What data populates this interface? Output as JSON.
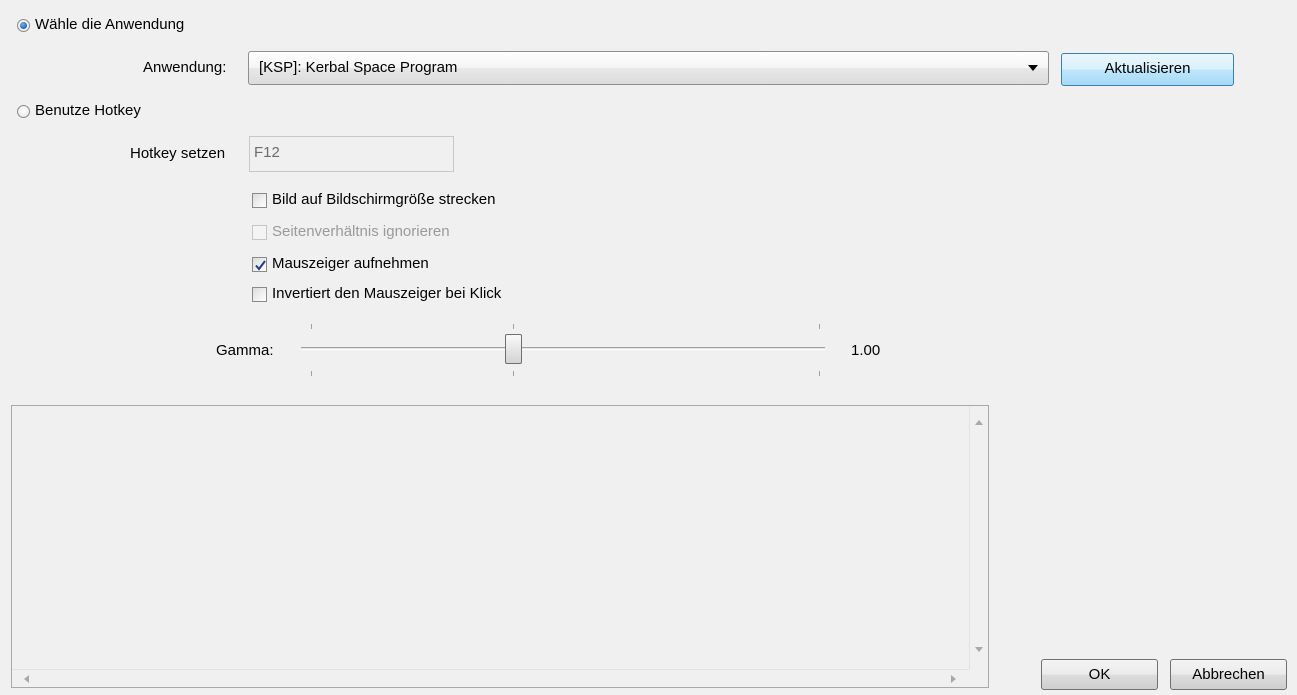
{
  "mode": {
    "app_radio_label": "Wähle die Anwendung",
    "hotkey_radio_label": "Benutze Hotkey",
    "selected": "application"
  },
  "application": {
    "label": "Anwendung:",
    "selected_value": "[KSP]: Kerbal Space Program",
    "refresh_button": "Aktualisieren"
  },
  "hotkey": {
    "label": "Hotkey setzen",
    "value": "F12"
  },
  "options": [
    {
      "label": "Bild auf Bildschirmgröße strecken",
      "checked": false,
      "enabled": true
    },
    {
      "label": "Seitenverhältnis ignorieren",
      "checked": false,
      "enabled": false
    },
    {
      "label": "Mauszeiger aufnehmen",
      "checked": true,
      "enabled": true
    },
    {
      "label": "Invertiert den Mauszeiger bei Klick",
      "checked": false,
      "enabled": true
    }
  ],
  "gamma": {
    "label": "Gamma:",
    "value": "1.00"
  },
  "buttons": {
    "ok": "OK",
    "cancel": "Abbrechen"
  },
  "colors": {
    "background": "#f0f0f0",
    "focus_button": "#bee6fd",
    "radio_selected": "#1f5fb6"
  }
}
